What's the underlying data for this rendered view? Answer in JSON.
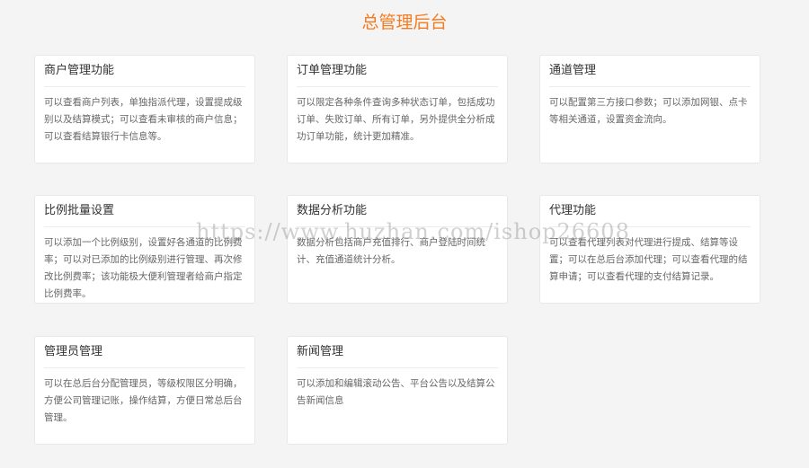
{
  "header": {
    "title": "总管理后台"
  },
  "cards": [
    {
      "title": "商户管理功能",
      "desc": "可以查看商户列表，单独指派代理，设置提成级别以及结算模式；可以查看未审核的商户信息；可以查看结算银行卡信息等。"
    },
    {
      "title": "订单管理功能",
      "desc": "可以限定各种条件查询多种状态订单，包括成功订单、失败订单、所有订单，另外提供全分析成功订单功能，统计更加精准。"
    },
    {
      "title": "通道管理",
      "desc": "可以配置第三方接口参数；可以添加网银、点卡等相关通道，设置资金流向。"
    },
    {
      "title": "比例批量设置",
      "desc": "可以添加一个比例级别，设置好各通道的比例费率；可以对已添加的比例级别进行管理、再次修改比例费率；该功能极大便利管理者给商户指定比例费率。"
    },
    {
      "title": "数据分析功能",
      "desc": "数据分析包括商户充值排行、商户登陆时间统计、充值通道统计分析。"
    },
    {
      "title": "代理功能",
      "desc": "可以查看代理列表对代理进行提成、结算等设置；可以在总后台添加代理；可以查看代理的结算申请；可以查看代理的支付结算记录。"
    },
    {
      "title": "管理员管理",
      "desc": "可以在总后台分配管理员，等级权限区分明确，方便公司管理记账，操作结算，方便日常总后台管理。"
    },
    {
      "title": "新闻管理",
      "desc": "可以添加和编辑滚动公告、平台公告以及结算公告新闻信息"
    }
  ],
  "watermark": "https://www.huzhan.com/ishop26608"
}
